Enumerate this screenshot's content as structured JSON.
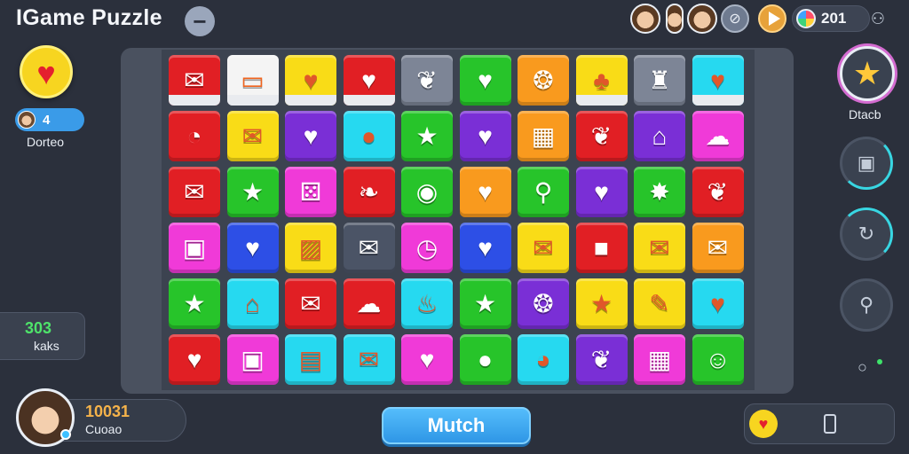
{
  "header": {
    "title": "IGame Puzzle",
    "minus_symbol": "−",
    "score": "201"
  },
  "left_panel": {
    "lives_count": "4",
    "lives_label": "Dorteo",
    "moves_value": "303",
    "moves_label": "kaks"
  },
  "player": {
    "score": "10031",
    "name": "Cuoao"
  },
  "right_panel": {
    "star_label": "Dtacb"
  },
  "actions": {
    "match_label": "Mutch"
  },
  "colors": {
    "red": "#e11f24",
    "white": "#f4f4f4",
    "yellow": "#f9dc17",
    "slate": "#7d8596",
    "green": "#27c42a",
    "orange": "#f99a1e",
    "cyan": "#26d9f0",
    "purple": "#7a2fd6",
    "magenta": "#f03ad8",
    "blue": "#2d4fe6",
    "dark": "#4b5466"
  },
  "board": {
    "rows": [
      [
        {
          "color": "red",
          "icon": "envelope-icon",
          "glyph": "✉",
          "banded": true
        },
        {
          "color": "white",
          "icon": "monitor-icon",
          "glyph": "▭",
          "banded": true
        },
        {
          "color": "yellow",
          "icon": "heart-icon",
          "glyph": "♥",
          "banded": true
        },
        {
          "color": "red",
          "icon": "heart-icon",
          "glyph": "♥",
          "banded": true
        },
        {
          "color": "slate",
          "icon": "leaf-icon",
          "glyph": "❦",
          "banded": false
        },
        {
          "color": "green",
          "icon": "heart-icon",
          "glyph": "♥",
          "banded": false
        },
        {
          "color": "orange",
          "icon": "swirl-icon",
          "glyph": "❂",
          "banded": false
        },
        {
          "color": "yellow",
          "icon": "creature-icon",
          "glyph": "♣",
          "banded": true
        },
        {
          "color": "slate",
          "icon": "trophy-icon",
          "glyph": "♜",
          "banded": false
        },
        {
          "color": "cyan",
          "icon": "heart-icon",
          "glyph": "♥",
          "banded": true
        }
      ],
      [
        {
          "color": "red",
          "icon": "clock-icon",
          "glyph": "◔",
          "banded": false
        },
        {
          "color": "yellow",
          "icon": "envelope-icon",
          "glyph": "✉",
          "banded": false
        },
        {
          "color": "purple",
          "icon": "heart-icon",
          "glyph": "♥",
          "banded": false
        },
        {
          "color": "cyan",
          "icon": "circle-icon",
          "glyph": "●",
          "banded": false
        },
        {
          "color": "green",
          "icon": "star-icon",
          "glyph": "★",
          "banded": false
        },
        {
          "color": "purple",
          "icon": "heart-icon",
          "glyph": "♥",
          "banded": false
        },
        {
          "color": "orange",
          "icon": "chart-icon",
          "glyph": "▦",
          "banded": false
        },
        {
          "color": "red",
          "icon": "bird-icon",
          "glyph": "❦",
          "banded": false
        },
        {
          "color": "purple",
          "icon": "house-icon",
          "glyph": "⌂",
          "banded": false
        },
        {
          "color": "magenta",
          "icon": "cloud-icon",
          "glyph": "☁",
          "banded": false
        }
      ],
      [
        {
          "color": "red",
          "icon": "envelope-icon",
          "glyph": "✉",
          "banded": false
        },
        {
          "color": "green",
          "icon": "star-icon",
          "glyph": "★",
          "banded": false
        },
        {
          "color": "magenta",
          "icon": "dice-icon",
          "glyph": "⚄",
          "banded": false
        },
        {
          "color": "red",
          "icon": "drop-icon",
          "glyph": "❧",
          "banded": false
        },
        {
          "color": "green",
          "icon": "circle-icon",
          "glyph": "◉",
          "banded": false
        },
        {
          "color": "orange",
          "icon": "heart-icon",
          "glyph": "♥",
          "banded": false
        },
        {
          "color": "green",
          "icon": "balloon-icon",
          "glyph": "⚲",
          "banded": false
        },
        {
          "color": "purple",
          "icon": "heart-icon",
          "glyph": "♥",
          "banded": false
        },
        {
          "color": "green",
          "icon": "star-icon",
          "glyph": "✸",
          "banded": false
        },
        {
          "color": "red",
          "icon": "leaf-icon",
          "glyph": "❦",
          "banded": false
        }
      ],
      [
        {
          "color": "magenta",
          "icon": "box-icon",
          "glyph": "▣",
          "banded": false
        },
        {
          "color": "blue",
          "icon": "heart-icon",
          "glyph": "♥",
          "banded": false
        },
        {
          "color": "yellow",
          "icon": "photo-icon",
          "glyph": "▨",
          "banded": false
        },
        {
          "color": "dark",
          "icon": "envelope-icon",
          "glyph": "✉",
          "banded": false
        },
        {
          "color": "magenta",
          "icon": "clock-icon",
          "glyph": "◷",
          "banded": false
        },
        {
          "color": "blue",
          "icon": "heart-icon",
          "glyph": "♥",
          "banded": false
        },
        {
          "color": "yellow",
          "icon": "envelope-icon",
          "glyph": "✉",
          "banded": false
        },
        {
          "color": "red",
          "icon": "square-icon",
          "glyph": "■",
          "banded": false
        },
        {
          "color": "yellow",
          "icon": "envelope-icon",
          "glyph": "✉",
          "banded": false
        },
        {
          "color": "orange",
          "icon": "envelope-icon",
          "glyph": "✉",
          "banded": false
        }
      ],
      [
        {
          "color": "green",
          "icon": "star-icon",
          "glyph": "★",
          "banded": false
        },
        {
          "color": "cyan",
          "icon": "home-icon",
          "glyph": "⌂",
          "banded": false
        },
        {
          "color": "red",
          "icon": "envelope-icon",
          "glyph": "✉",
          "banded": false
        },
        {
          "color": "red",
          "icon": "cloud-icon",
          "glyph": "☁",
          "banded": false
        },
        {
          "color": "cyan",
          "icon": "flame-icon",
          "glyph": "♨",
          "banded": false
        },
        {
          "color": "green",
          "icon": "star-icon",
          "glyph": "★",
          "banded": false
        },
        {
          "color": "purple",
          "icon": "swirl-icon",
          "glyph": "❂",
          "banded": false
        },
        {
          "color": "yellow",
          "icon": "star-icon",
          "glyph": "★",
          "banded": false
        },
        {
          "color": "yellow",
          "icon": "chat-icon",
          "glyph": "✎",
          "banded": false
        },
        {
          "color": "cyan",
          "icon": "heart-icon",
          "glyph": "♥",
          "banded": false
        }
      ],
      [
        {
          "color": "red",
          "icon": "heart-icon",
          "glyph": "♥",
          "banded": false
        },
        {
          "color": "magenta",
          "icon": "box-icon",
          "glyph": "▣",
          "banded": false
        },
        {
          "color": "cyan",
          "icon": "lock-icon",
          "glyph": "▤",
          "banded": false
        },
        {
          "color": "cyan",
          "icon": "envelope-icon",
          "glyph": "✉",
          "banded": false
        },
        {
          "color": "magenta",
          "icon": "heart-icon",
          "glyph": "♥",
          "banded": false
        },
        {
          "color": "green",
          "icon": "chat-icon",
          "glyph": "●",
          "banded": false
        },
        {
          "color": "cyan",
          "icon": "orb-icon",
          "glyph": "◕",
          "banded": false
        },
        {
          "color": "purple",
          "icon": "bird-icon",
          "glyph": "❦",
          "banded": false
        },
        {
          "color": "magenta",
          "icon": "gift-icon",
          "glyph": "▦",
          "banded": false
        },
        {
          "color": "green",
          "icon": "smile-icon",
          "glyph": "☺",
          "banded": false
        }
      ]
    ]
  }
}
